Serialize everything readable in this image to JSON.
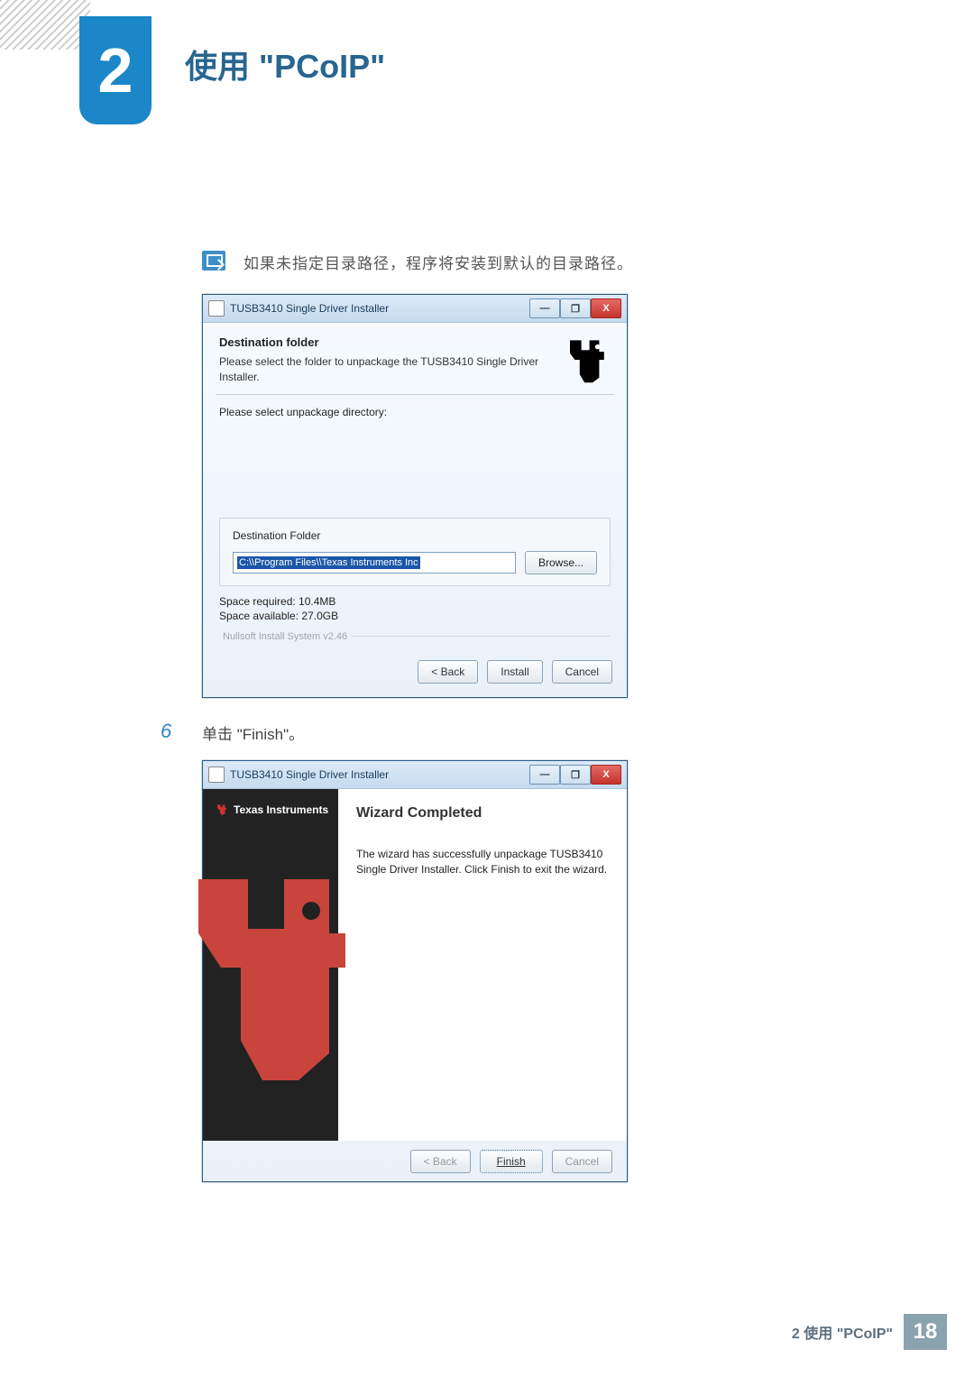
{
  "header": {
    "chapter_number": "2",
    "chapter_title": "使用 \"PCoIP\""
  },
  "note": {
    "text": "如果未指定目录路径，程序将安装到默认的目录路径。"
  },
  "installer1": {
    "title": "TUSB3410 Single Driver Installer",
    "heading": "Destination folder",
    "subheading": "Please select the folder to unpackage the TUSB3410 Single Driver Installer.",
    "prompt": "Please select unpackage directory:",
    "dest_label": "Destination Folder",
    "path": "C:\\\\Program Files\\\\Texas Instruments Inc",
    "browse": "Browse...",
    "space_required": "Space required: 10.4MB",
    "space_available": "Space available: 27.0GB",
    "nullsoft": "Nullsoft Install System v2.46",
    "back": "< Back",
    "install": "Install",
    "cancel": "Cancel",
    "win_min": "—",
    "win_max": "❐",
    "win_close": "X"
  },
  "step6": {
    "number": "6",
    "text": "单击 \"Finish\"。"
  },
  "installer2": {
    "title": "TUSB3410 Single Driver Installer",
    "brand": "Texas Instruments",
    "heading": "Wizard Completed",
    "desc": "The wizard has successfully unpackage TUSB3410 Single Driver Installer. Click Finish to exit the wizard.",
    "back": "< Back",
    "finish": "Finish",
    "cancel": "Cancel",
    "win_min": "—",
    "win_max": "❐",
    "win_close": "X"
  },
  "footer": {
    "text": "2 使用 \"PCoIP\"",
    "page": "18"
  }
}
